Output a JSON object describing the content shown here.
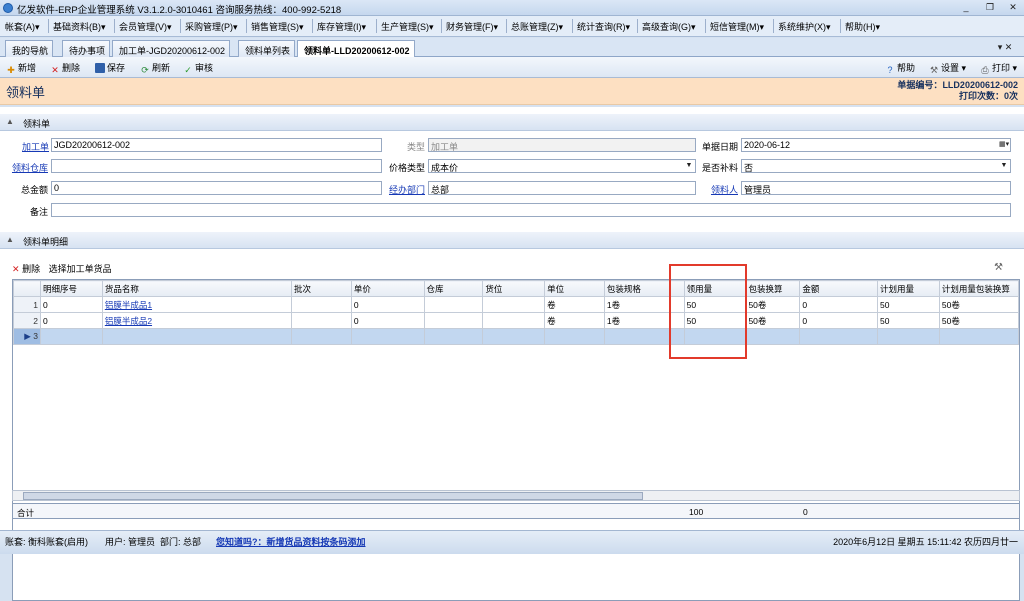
{
  "window": {
    "title": "亿发软件-ERP企业管理系统 V3.1.2.0-3010461  咨询服务热线：400-992-5218",
    "minimize": "_",
    "restore": "❐",
    "close": "✕"
  },
  "menu": [
    "帐套(A)▾",
    "基础资料(B)▾",
    "会员管理(V)▾",
    "采购管理(P)▾",
    "销售管理(S)▾",
    "库存管理(I)▾",
    "生产管理(S)▾",
    "财务管理(F)▾",
    "总账管理(Z)▾",
    "统计查询(R)▾",
    "高级查询(G)▾",
    "短信管理(M)▾",
    "系统维护(X)▾",
    "帮助(H)▾"
  ],
  "tabs": [
    "我的导航",
    "待办事项",
    "加工单-JGD20200612-002",
    "领料单列表",
    "领料单-LLD20200612-002"
  ],
  "tab_close": "▾ ✕",
  "toolbar": {
    "new": "新增",
    "delete": "删除",
    "save": "保存",
    "refresh": "刷新",
    "audit": "审核",
    "help": "帮助",
    "settings": "设置 ▾",
    "print": "打印 ▾"
  },
  "header": {
    "title": "领料单",
    "doc_no_label": "单据编号：",
    "doc_no": "LLD20200612-002",
    "print_label": "打印次数：",
    "print_count": "0次"
  },
  "section1": "领料单",
  "form": {
    "process_order_label": "加工单",
    "process_order": "JGD20200612-002",
    "type_label": "类型",
    "type": "加工单",
    "doc_date_label": "单据日期",
    "doc_date": "2020-06-12",
    "warehouse_label": "领料仓库",
    "warehouse": "",
    "price_type_label": "价格类型",
    "price_type": "成本价",
    "fill_label": "是否补料",
    "fill": "否",
    "total_label": "总金额",
    "total": "0",
    "dept_label": "经办部门",
    "dept": "总部",
    "receiver_label": "领料人",
    "receiver": "管理员",
    "remark_label": "备注",
    "remark": ""
  },
  "section2": "领料单明细",
  "grid_toolbar": {
    "delete": "删除",
    "select": "选择加工单货品"
  },
  "grid": {
    "columns": [
      "明细序号",
      "货品名称",
      "批次",
      "单价",
      "仓库",
      "货位",
      "单位",
      "包装规格",
      "领用量",
      "包装换算",
      "金额",
      "计划用量",
      "计划用量包装换算"
    ],
    "rows": [
      {
        "n": "1",
        "cells": [
          "0",
          "铝膜半成品1",
          "",
          "0",
          "",
          "",
          "卷",
          "1卷",
          "50",
          "50卷",
          "0",
          "50",
          "50卷"
        ]
      },
      {
        "n": "2",
        "cells": [
          "0",
          "铝膜半成品2",
          "",
          "0",
          "",
          "",
          "卷",
          "1卷",
          "50",
          "50卷",
          "0",
          "50",
          "50卷"
        ]
      }
    ],
    "new_row": "3",
    "totals_label": "合计",
    "total_qty": "100",
    "total_amount": "0"
  },
  "status": {
    "account": "账套: 衡科账套(启用)",
    "user": "用户: 管理员",
    "dept": "部门: 总部",
    "tip": "您知道吗?：新增货品资料按条码添加",
    "datetime": "2020年6月12日 星期五 15:11:42 农历四月廿一"
  }
}
